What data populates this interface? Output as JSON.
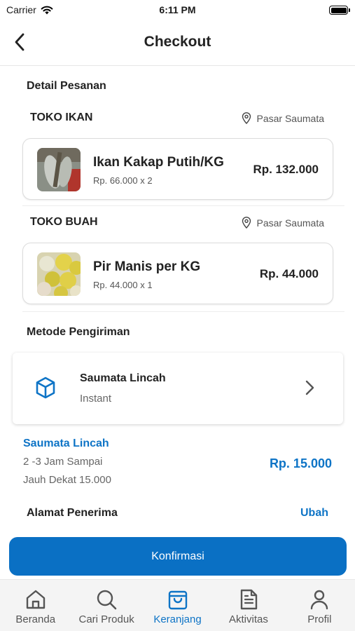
{
  "status_bar": {
    "carrier": "Carrier",
    "time": "6:11 PM"
  },
  "header": {
    "title": "Checkout"
  },
  "order": {
    "section_title": "Detail Pesanan",
    "stores": [
      {
        "name": "TOKO IKAN",
        "location": "Pasar Saumata",
        "item": {
          "name": "Ikan Kakap Putih/KG",
          "qty_line": "Rp. 66.000 x 2",
          "price": "Rp. 132.000",
          "image_icon": "fish-photo"
        }
      },
      {
        "name": "TOKO BUAH",
        "location": "Pasar Saumata",
        "item": {
          "name": "Pir Manis per KG",
          "qty_line": "Rp. 44.000 x 1",
          "price": "Rp. 44.000",
          "image_icon": "pear-photo"
        }
      }
    ]
  },
  "shipping": {
    "section_title": "Metode Pengiriman",
    "method_name": "Saumata Lincah",
    "method_type": "Instant",
    "icon": "box-icon"
  },
  "summary": {
    "name": "Saumata Lincah",
    "eta": "2 -3 Jam Sampai",
    "note": "Jauh Dekat 15.000",
    "price": "Rp. 15.000"
  },
  "address": {
    "title": "Alamat Penerima",
    "change_label": "Ubah"
  },
  "confirm_label": "Konfirmasi",
  "tabs": [
    {
      "label": "Beranda",
      "icon": "home-icon",
      "active": false
    },
    {
      "label": "Cari Produk",
      "icon": "search-icon",
      "active": false
    },
    {
      "label": "Keranjang",
      "icon": "bag-icon",
      "active": true
    },
    {
      "label": "Aktivitas",
      "icon": "document-icon",
      "active": false
    },
    {
      "label": "Profil",
      "icon": "person-icon",
      "active": false
    }
  ],
  "colors": {
    "accent": "#0e74c6",
    "button": "#0a70c4",
    "tab_bar": "#f4f4f4"
  }
}
